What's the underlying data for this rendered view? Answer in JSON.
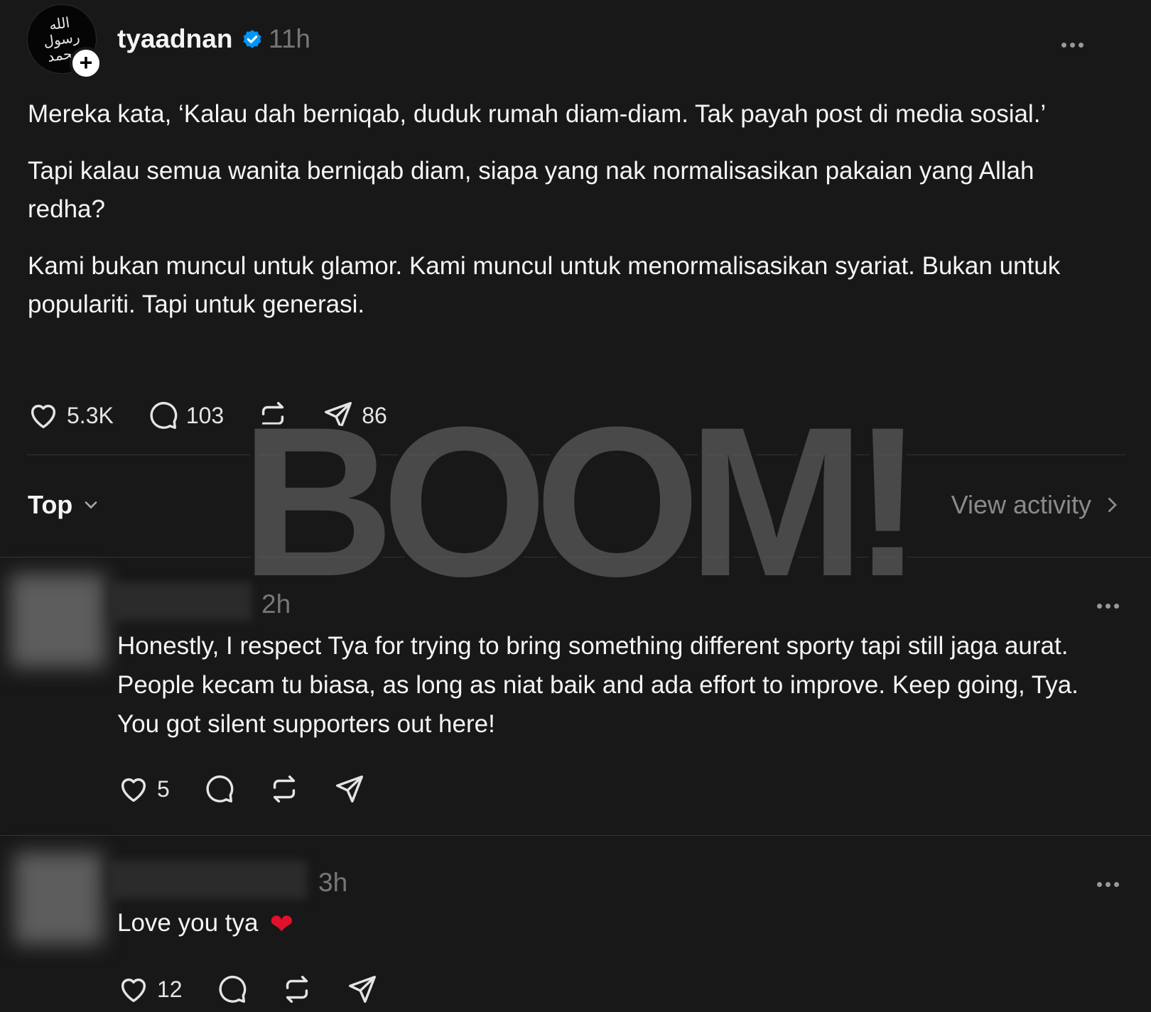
{
  "post": {
    "username": "tyaadnan",
    "time": "11h",
    "paragraphs": [
      "Mereka kata, ‘Kalau dah berniqab, duduk rumah diam-diam. Tak payah post di media sosial.’",
      "Tapi kalau semua wanita berniqab diam, siapa yang nak normalisasikan pakaian yang Allah redha?",
      "Kami bukan muncul untuk glamor. Kami muncul untuk menormalisasikan syariat. Bukan untuk populariti. Tapi untuk generasi."
    ],
    "likes": "5.3K",
    "replies": "103",
    "shares": "86"
  },
  "filter": {
    "sort_label": "Top",
    "view_activity": "View activity"
  },
  "replies": [
    {
      "time": "2h",
      "text": "Honestly, I respect Tya for trying to bring something different sporty tapi still jaga aurat. People kecam tu biasa, as long as niat baik and ada effort to improve. Keep going, Tya. You got silent supporters out here!",
      "likes": "5"
    },
    {
      "time": "3h",
      "text": "Love you tya",
      "likes": "12"
    }
  ],
  "watermark": {
    "text": "BOOM!"
  },
  "icons": {
    "avatar": "calligraphy-seal-icon",
    "verified": "verified-badge-icon",
    "like": "heart-icon",
    "reply": "comment-bubble-icon",
    "repost": "repost-icon",
    "share": "send-icon",
    "more": "more-horizontal-icon"
  },
  "colors": {
    "background": "#181818",
    "verified": "#0095f6",
    "heart_emoji": "#e3102c"
  }
}
